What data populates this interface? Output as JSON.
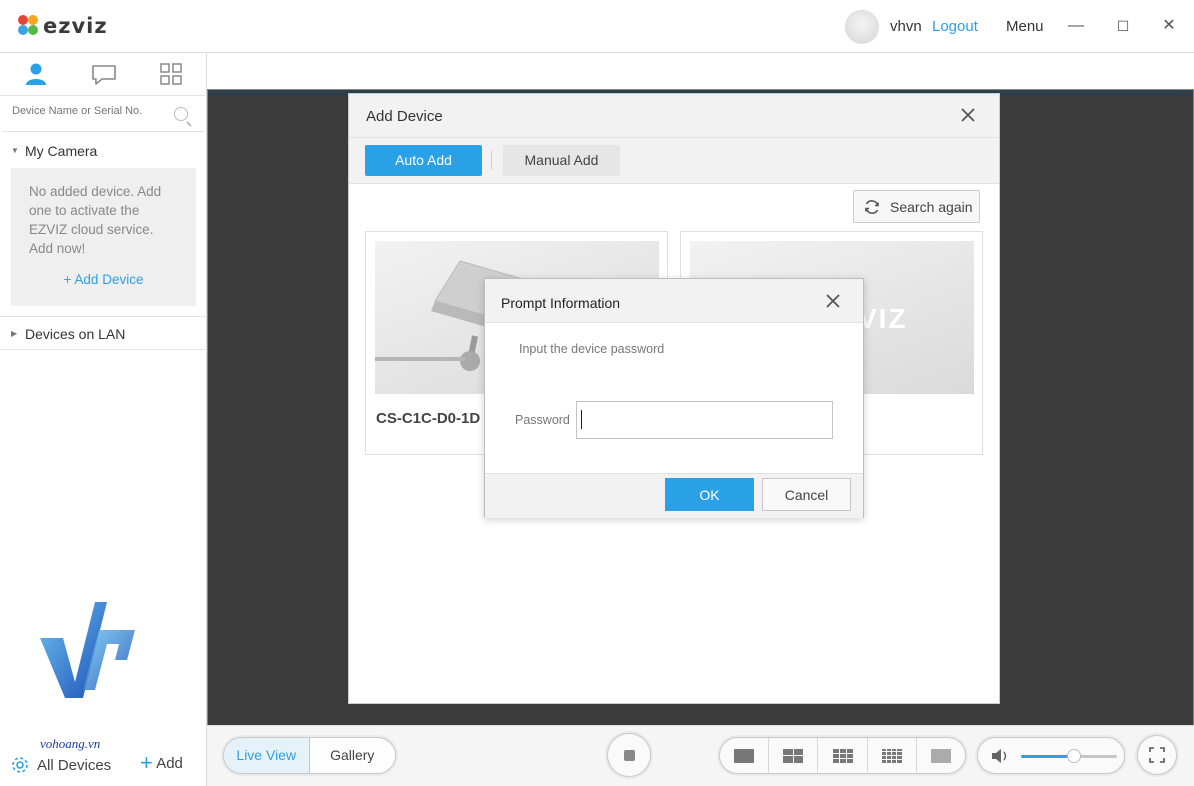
{
  "app": {
    "logo_text": "ezviz"
  },
  "header": {
    "username": "vhvn",
    "logout_label": "Logout",
    "menu_label": "Menu",
    "minimize_glyph": "—",
    "maximize_glyph": "☐",
    "close_glyph": "✕"
  },
  "sidebar": {
    "tabs": [
      {
        "name": "person-icon",
        "active": true
      },
      {
        "name": "chat-bubble-icon",
        "active": false
      },
      {
        "name": "grid-icon",
        "active": false
      }
    ],
    "search": {
      "placeholder": "Device Name or Serial No."
    },
    "my_camera": {
      "label": "My Camera",
      "empty_message": "No added device. Add one to activate the EZVIZ cloud service. Add now!",
      "add_link": "+ Add Device"
    },
    "devices_on_lan": {
      "label": "Devices on LAN"
    },
    "bottom": {
      "all_devices_label": "All Devices",
      "add_label": "Add"
    },
    "watermark_text": "vohoang.vn"
  },
  "bottom_bar": {
    "live_view_label": "Live View",
    "gallery_label": "Gallery",
    "layouts": [
      "1x1",
      "2x2",
      "3x3",
      "4x4",
      "5x5"
    ],
    "volume_level": 0.55
  },
  "add_device_dialog": {
    "title": "Add Device",
    "tabs": {
      "auto_add": "Auto Add",
      "manual_add": "Manual Add"
    },
    "search_again_label": "Search again",
    "cards": [
      {
        "name": "CS-C1C-D0-1D"
      },
      {
        "name": "",
        "image_text": "VIZ"
      }
    ]
  },
  "prompt_dialog": {
    "title": "Prompt Information",
    "hint": "Input the device password",
    "password_label": "Password",
    "password_value": "",
    "ok_label": "OK",
    "cancel_label": "Cancel"
  },
  "colors": {
    "accent": "#2aa1e6",
    "video_bg": "#3b3b3b",
    "panel_bg": "#f2f2f2"
  }
}
